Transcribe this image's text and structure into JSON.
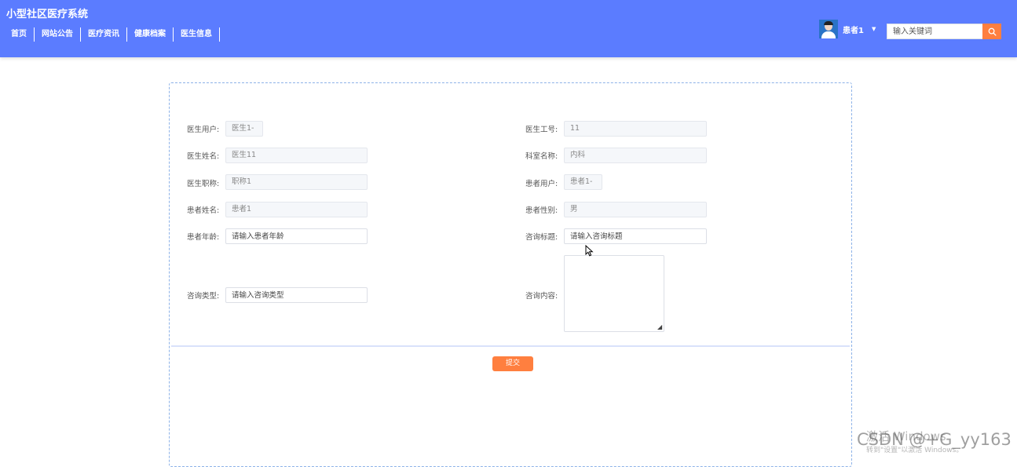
{
  "header": {
    "title": "小型社区医疗系统",
    "nav": [
      "首页",
      "网站公告",
      "医疗资讯",
      "健康档案",
      "医生信息"
    ],
    "user": {
      "name": "患者1"
    },
    "search": {
      "placeholder": "输入关键词"
    }
  },
  "form": {
    "left": [
      {
        "label": "医生用户:",
        "value": "医生1-"
      },
      {
        "label": "医生姓名:",
        "value": "医生11"
      },
      {
        "label": "医生职称:",
        "value": "职称1"
      },
      {
        "label": "患者姓名:",
        "value": "患者1"
      },
      {
        "label": "患者年龄:",
        "placeholder": "请输入患者年龄"
      },
      {
        "label": "咨询类型:",
        "placeholder": "请输入咨询类型"
      }
    ],
    "right": [
      {
        "label": "医生工号:",
        "value": "11"
      },
      {
        "label": "科室名称:",
        "value": "内科"
      },
      {
        "label": "患者用户:",
        "value": "患者1-"
      },
      {
        "label": "患者性别:",
        "value": "男"
      },
      {
        "label": "咨询标题:",
        "placeholder": "请输入咨询标题"
      },
      {
        "label": "咨询内容:",
        "value": ""
      }
    ],
    "submit_label": "提交"
  },
  "overlay": {
    "activate_line1": "激活 Windows",
    "activate_line2": "转到\"设置\"以激活 Windows。",
    "csdn": "CSDN @+G_yy163"
  },
  "colors": {
    "header_bg": "#5b7cff",
    "accent": "#ff7f3f",
    "panel_border": "#8db2e8"
  }
}
